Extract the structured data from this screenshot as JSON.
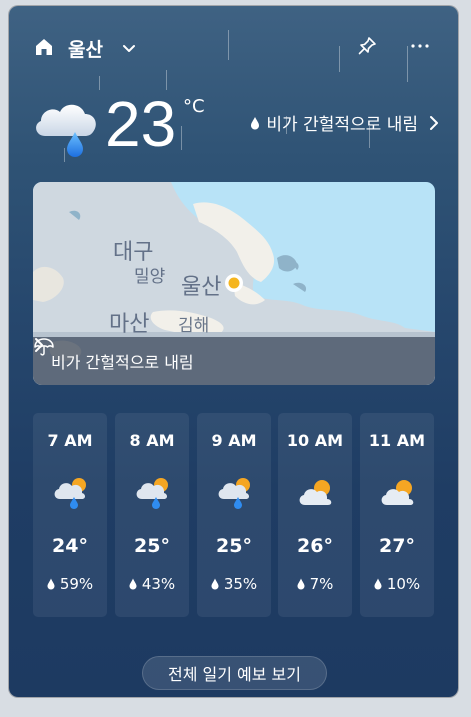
{
  "header": {
    "location": "울산",
    "icons": [
      "home-icon",
      "chevron-down-icon",
      "pin-icon",
      "more-icon"
    ]
  },
  "current": {
    "temperature": "23",
    "unit": "°C",
    "condition": "비가 간헐적으로 내림",
    "icon": "cloud-rain-icon"
  },
  "map": {
    "labels": {
      "daegu": "대구",
      "miryang": "밀양",
      "ulsan": "울산",
      "masan": "마산",
      "gimhae": "김해"
    },
    "alert": "비가 간헐적으로 내림"
  },
  "hourly": [
    {
      "time": "7 AM",
      "temp": "24°",
      "precip": "59%",
      "icon": "rain-sun-icon"
    },
    {
      "time": "8 AM",
      "temp": "25°",
      "precip": "43%",
      "icon": "rain-sun-icon"
    },
    {
      "time": "9 AM",
      "temp": "25°",
      "precip": "35%",
      "icon": "rain-sun-icon"
    },
    {
      "time": "10 AM",
      "temp": "26°",
      "precip": "7%",
      "icon": "partly-cloudy-icon"
    },
    {
      "time": "11 AM",
      "temp": "27°",
      "precip": "10%",
      "icon": "partly-cloudy-icon"
    }
  ],
  "footer": {
    "button_label": "전체 일기 예보 보기"
  },
  "colors": {
    "card_top": "#3f6283",
    "card_bottom": "#1d3a61",
    "sun": "#f5a623",
    "rain_drop": "#2f8cf0",
    "map_water": "#b8e3f7"
  }
}
